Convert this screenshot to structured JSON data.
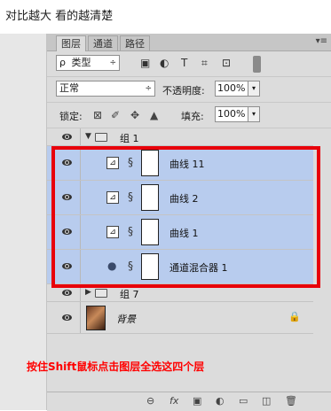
{
  "caption": "对比越大 看的越清楚",
  "tabs": [
    {
      "label": "图层",
      "active": true
    },
    {
      "label": "通道",
      "active": false
    },
    {
      "label": "路径",
      "active": false
    }
  ],
  "panel_menu": "▾≡",
  "filter": {
    "search_glyph": "ρ",
    "label": "类型",
    "arrow": "÷",
    "icons": [
      "image-filter-icon",
      "adjustment-filter-icon",
      "type-filter-icon",
      "shape-filter-icon",
      "smart-object-filter-icon"
    ],
    "icon_glyphs": [
      "▣",
      "◐",
      "T",
      "⌗",
      "⊡"
    ]
  },
  "blend": {
    "mode": "正常",
    "arrow": "÷",
    "opacity_label": "不透明度:",
    "opacity_value": "100%",
    "dropdown_arrow": "▾"
  },
  "lock": {
    "label": "锁定:",
    "icon_glyphs": [
      "⊠",
      "✐",
      "✥",
      "▲"
    ],
    "fill_label": "填充:",
    "fill_value": "100%",
    "dropdown_arrow": "▾"
  },
  "layers": {
    "group1": {
      "name": "组 1",
      "arrow": "▼"
    },
    "items": [
      {
        "name": "曲线 11",
        "type": "curves",
        "selected": true
      },
      {
        "name": "曲线 2",
        "type": "curves",
        "selected": true
      },
      {
        "name": "曲线 1",
        "type": "curves",
        "selected": true
      },
      {
        "name": "通道混合器 1",
        "type": "channel-mixer",
        "selected": true
      }
    ],
    "group7": {
      "name": "组 7",
      "arrow": "▶"
    },
    "background": {
      "name": "背景",
      "lock_glyph": "🔒"
    },
    "curves_glyph": "⊿",
    "mixer_glyph": "●",
    "link_glyph": "§"
  },
  "instruction": "按住Shift鼠标点击图层全选这四个层",
  "bottom_icons": {
    "link": "⊖",
    "fx": "fx",
    "mask": "▣",
    "adjustment": "◐",
    "group": "▭",
    "new_layer": "◫",
    "delete": "🗑"
  },
  "colors": {
    "selection": "#b8ccee",
    "highlight_box": "#e8000a",
    "instruction_text": "#ff0000"
  }
}
